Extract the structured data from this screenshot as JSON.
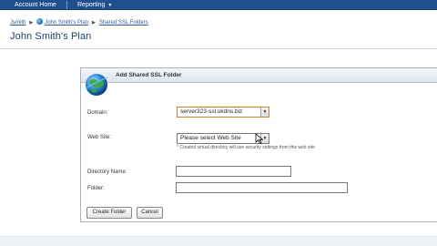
{
  "topnav": {
    "tabs": [
      {
        "label": "Account Home"
      },
      {
        "label": "Reporting"
      }
    ]
  },
  "breadcrumb": {
    "items": [
      "Jsmith",
      "John Smith's Plan",
      "Shared SSL Folders"
    ]
  },
  "page": {
    "title": "John Smith's Plan"
  },
  "dialog": {
    "title": "Add Shared SSL Folder",
    "fields": {
      "domain_label": "Domain:",
      "domain_value": "server323-ssl.ukdns.biz",
      "website_label": "Web Site:",
      "website_value": "Please select Web Site",
      "website_hint": "* Created virtual directory will use security settings from this web site",
      "dirname_label": "Directory Name:",
      "dirname_value": "",
      "folder_label": "Folder:",
      "folder_value": ""
    },
    "buttons": {
      "create": "Create Folder",
      "cancel": "Cancel"
    }
  },
  "colors": {
    "topbar": "#1f4f8e",
    "title": "#1c3f77",
    "link": "#2b5aa0"
  }
}
